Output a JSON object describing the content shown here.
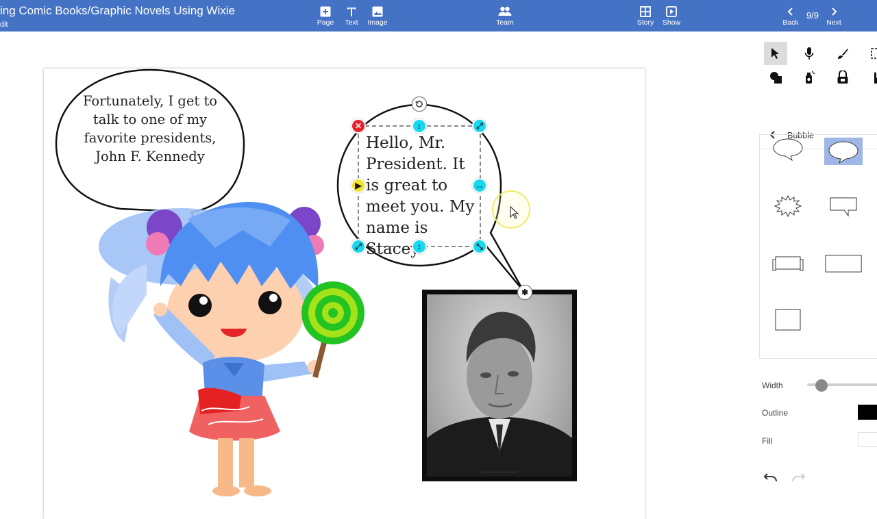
{
  "topbar": {
    "title": "ing Comic Books/Graphic Novels Using Wixie",
    "subtitle": "dit",
    "buttons": {
      "page": "Page",
      "text": "Text",
      "image": "Image",
      "team": "Team",
      "story": "Story",
      "show": "Show",
      "back": "Back",
      "next": "Next"
    },
    "page_counter": "9/9"
  },
  "canvas": {
    "bubble_left_text": "Fortunately, I get to talk to one of my favorite presidents, John F. Kennedy",
    "bubble_right_text": "Hello, Mr. President. It is great to meet you. My name is Stacey.",
    "photo_caption": "President John F. Kennedy"
  },
  "panel": {
    "section_title": "Bubble",
    "tools": [
      "pointer-icon",
      "microphone-icon",
      "brush-icon",
      "select-box-icon",
      "shapes-icon",
      "spray-icon",
      "stamp-icon",
      "hand-icon"
    ],
    "props": {
      "width_label": "Width",
      "outline_label": "Outline",
      "fill_label": "Fill",
      "width_value": 0.2
    },
    "colors": {
      "outline": "#000000",
      "fill": "#ffffff",
      "selected_shape": "#9fb7e6"
    }
  },
  "theme": {
    "topbar": "#4472c4",
    "handle_cyan": "#18d8f0",
    "handle_red": "#e8202a",
    "handle_yellow": "#f2e22c"
  }
}
